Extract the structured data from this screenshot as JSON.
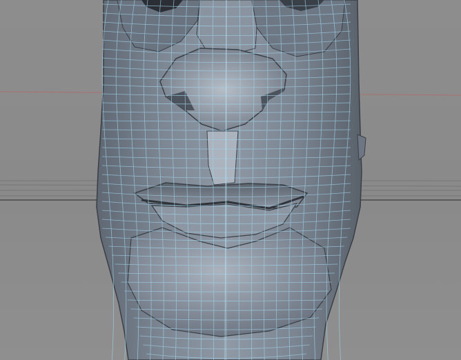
{
  "viewport": {
    "background_color": "#8e8e8e",
    "horizon_color": "#5a5a5a",
    "axis_x_color": "#c0504d",
    "mesh_fill_color": "#7b8592",
    "mesh_shade_color": "#5c6571",
    "mesh_highlight_color": "#a9b2bd",
    "wire_color": "#9fd2ea",
    "edge_color": "#3a3f46",
    "shading_mode": "smooth-shaded-with-wireframe",
    "subject": "polygon-head-mesh"
  }
}
